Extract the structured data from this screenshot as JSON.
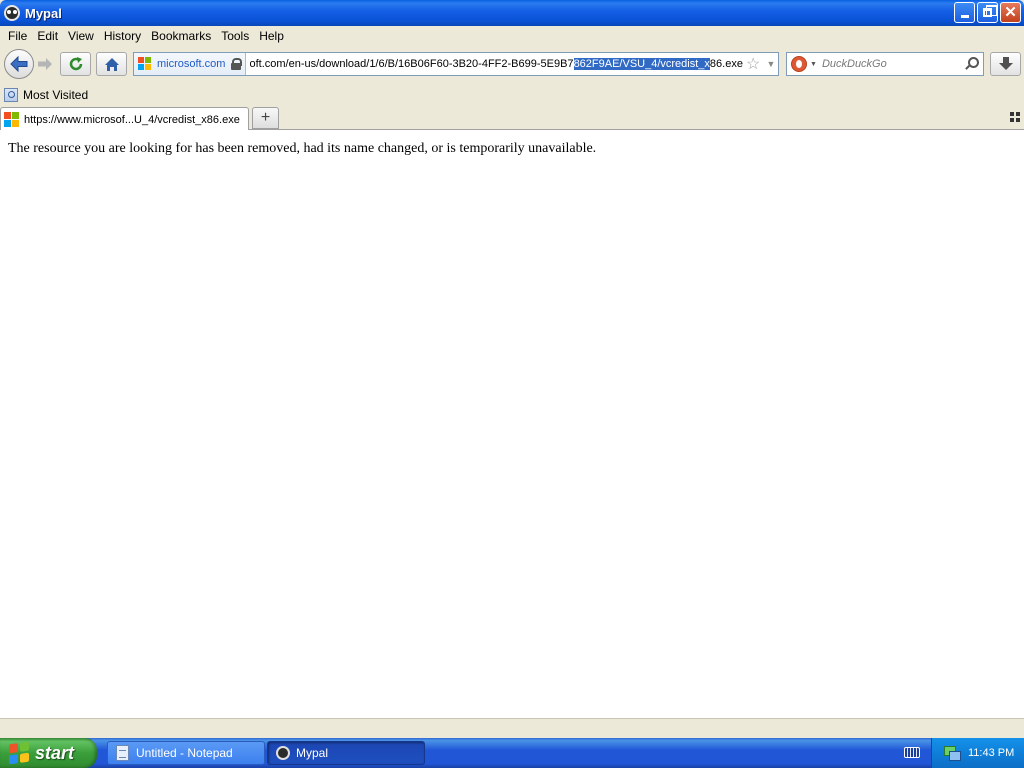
{
  "window": {
    "title": "Mypal"
  },
  "menu": [
    "File",
    "Edit",
    "View",
    "History",
    "Bookmarks",
    "Tools",
    "Help"
  ],
  "navbar": {
    "identity": "microsoft.com",
    "url_before": "oft.com/en-us/download/1/6/B/16B06F60-3B20-4FF2-B699-5E9B7",
    "url_selected": "862F9AE/VSU_4/vcredist_x",
    "url_after": "86.exe",
    "search_placeholder": "DuckDuckGo"
  },
  "bookmarks": {
    "most_visited": "Most Visited"
  },
  "tab": {
    "title": "https://www.microsof...U_4/vcredist_x86.exe"
  },
  "content": {
    "message": "The resource you are looking for has been removed, had its name changed, or is temporarily unavailable."
  },
  "taskbar": {
    "start_label": "start",
    "tasks": [
      "Untitled - Notepad",
      "Mypal"
    ],
    "clock": "11:43 PM"
  },
  "colors": {
    "ms_red": "#f25022",
    "ms_green": "#7fba00",
    "ms_blue": "#00a4ef",
    "ms_yellow": "#ffb900",
    "selection": "#316ac5"
  }
}
